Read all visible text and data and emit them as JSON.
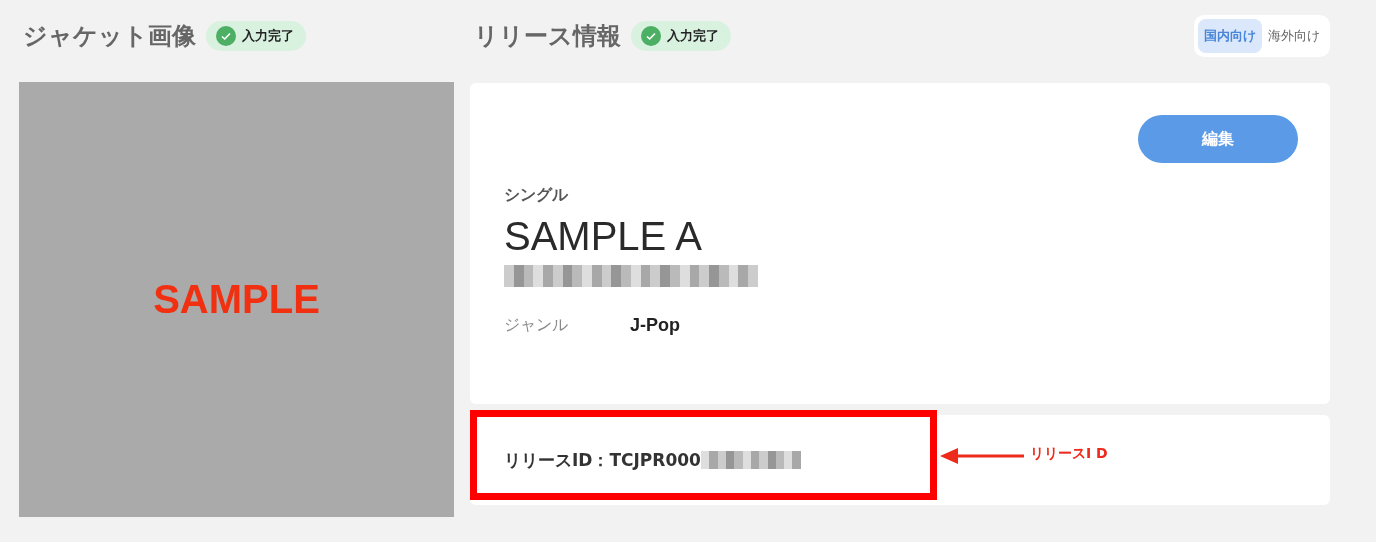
{
  "jacket": {
    "title": "ジャケット画像",
    "status": "入力完了",
    "sample_text": "SAMPLE"
  },
  "release": {
    "title": "リリース情報",
    "status": "入力完了",
    "region_tabs": [
      {
        "label": "国内向け",
        "selected": true
      },
      {
        "label": "海外向け",
        "selected": false
      }
    ],
    "edit_button": "編集",
    "type": "シングル",
    "name": "SAMPLE A",
    "fields": [
      {
        "label": "ジャンル",
        "value": "J-Pop"
      }
    ],
    "release_id": "リリースID：TCJPR000"
  },
  "annotation": {
    "label": "リリースI D"
  }
}
